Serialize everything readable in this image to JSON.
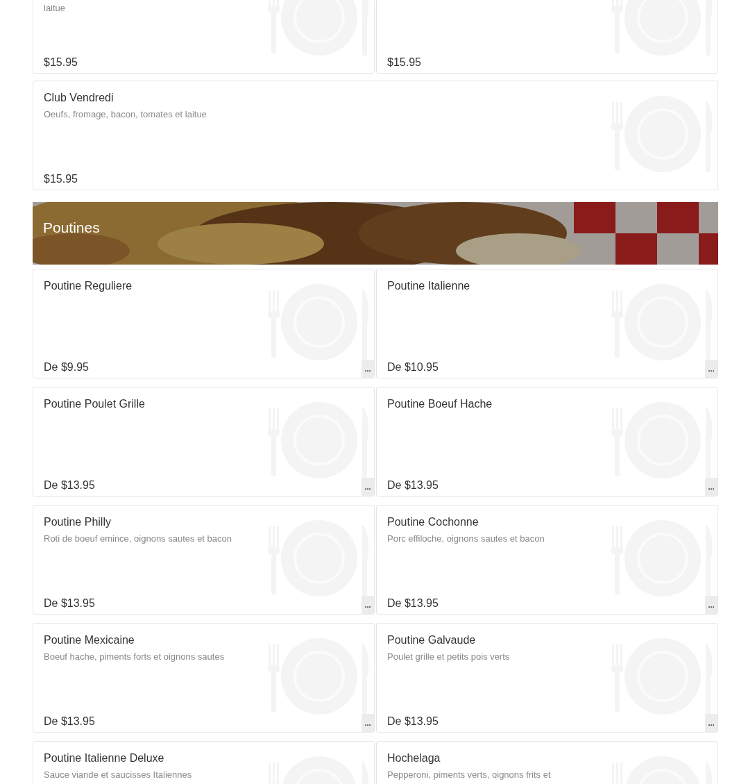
{
  "previous_items": [
    {
      "kind": "cut",
      "description": "laitue",
      "price": "$15.95"
    },
    {
      "kind": "cut",
      "price": "$15.95"
    },
    {
      "kind": "full",
      "title": "Club Vendredi",
      "description": "Oeufs, fromage, bacon, tomates et laitue",
      "price": "$15.95"
    }
  ],
  "section": {
    "title": "Poutines"
  },
  "items": [
    {
      "title": "Poutine Reguliere",
      "price": "De $9.95",
      "more_button": "..."
    },
    {
      "title": "Poutine Italienne",
      "price": "De $10.95",
      "more_button": "..."
    },
    {
      "title": "Poutine Poulet Grille",
      "price": "De $13.95",
      "more_button": "..."
    },
    {
      "title": "Poutine Boeuf Hache",
      "price": "De $13.95",
      "more_button": "..."
    },
    {
      "title": "Poutine Philly",
      "description": "Roti de boeuf emince, oignons sautes et bacon",
      "price": "De $13.95",
      "more_button": "..."
    },
    {
      "title": "Poutine Cochonne",
      "description": "Porc effiloche, oignons sautes et bacon",
      "price": "De $13.95",
      "more_button": "..."
    },
    {
      "title": "Poutine Mexicaine",
      "description": "Boeuf hache, piments forts et oignons sautes",
      "price": "De $13.95",
      "more_button": "..."
    },
    {
      "title": "Poutine Galvaude",
      "description": "Poulet grille et petits pois verts",
      "price": "De $13.95",
      "more_button": "..."
    },
    {
      "title": "Poutine Italienne Deluxe",
      "description": "Sauce viande et saucisses Italiennes"
    },
    {
      "title": "Hochelaga",
      "description": "Pepperoni, piments verts, oignons frits et"
    }
  ]
}
